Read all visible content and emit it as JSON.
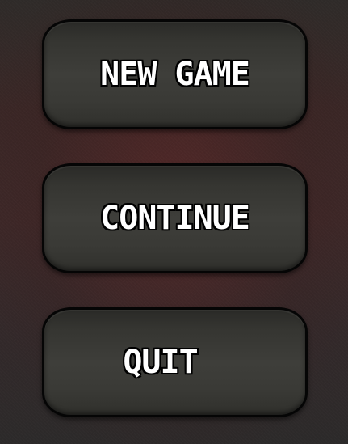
{
  "main_menu": {
    "buttons": [
      {
        "id": "new_game",
        "label": "NEW GAME"
      },
      {
        "id": "continue",
        "label": "CONTINUE"
      },
      {
        "id": "quit",
        "label": "QUIT"
      }
    ]
  },
  "colors": {
    "background": "#3a2726",
    "button_fill": "#3e3e3a",
    "button_border": "#050505",
    "label_text": "#ffffff"
  }
}
